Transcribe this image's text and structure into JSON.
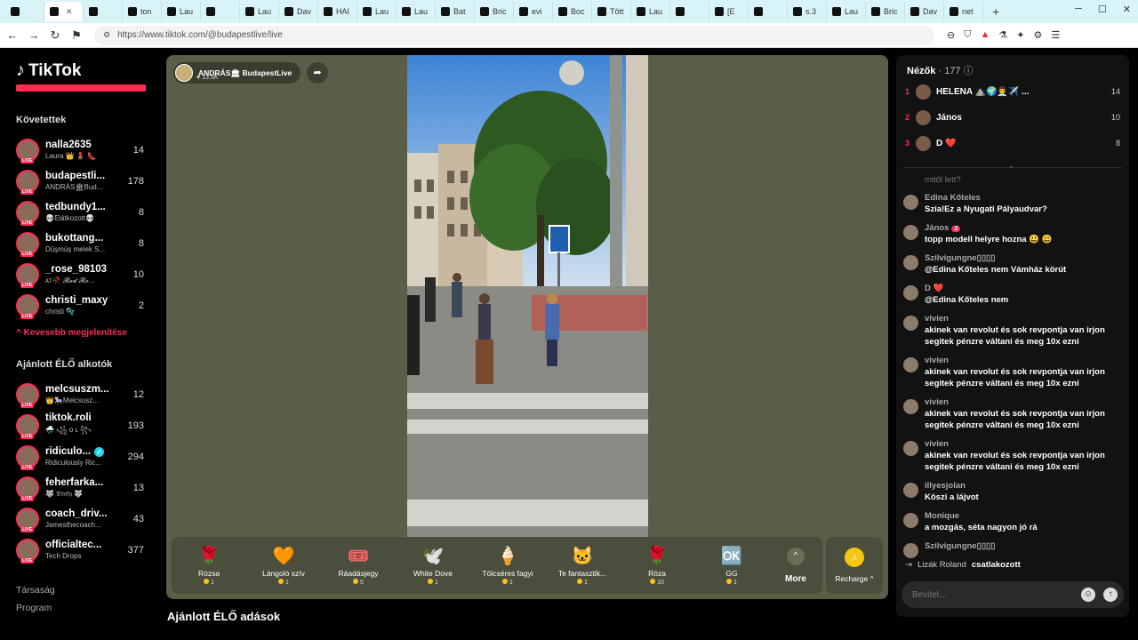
{
  "browser": {
    "tabs": [
      "",
      "",
      "",
      "ton",
      "Lau",
      "",
      "Lau",
      "Dav",
      "HAI",
      "Lau",
      "Lau",
      "Bat",
      "Bric",
      "evi",
      "Boc",
      "Tött",
      "Lau",
      "",
      "[E",
      "",
      "s.3",
      "Lau",
      "Bric",
      "Dav",
      "net"
    ],
    "url": "https://www.tiktok.com/@budapestlive/live"
  },
  "sidebar": {
    "logo": "TikTok",
    "following_title": "Követettek",
    "following": [
      {
        "name": "nalla2635",
        "sub": "Laura 👑 💄 👠",
        "count": "14"
      },
      {
        "name": "budapestli...",
        "sub": "ANDRÁS🏛Bud...",
        "count": "178"
      },
      {
        "name": "tedbundy1...",
        "sub": "💀Elátkozott💀",
        "count": "8"
      },
      {
        "name": "bukottang...",
        "sub": "Düşmüş melek S...",
        "count": "8"
      },
      {
        "name": "_rose_98103",
        "sub": "ᴀᴛ🥀 𝓡𝓮𝓭 𝓡𝓸...",
        "count": "10"
      },
      {
        "name": "christi_maxy",
        "sub": "christi 🫧",
        "count": "2"
      }
    ],
    "show_less": "Kevesebb megjelenítése",
    "recommended_title": "Ajánlott ÉLŐ alkotók",
    "recommended": [
      {
        "name": "melcsuszm...",
        "sub": "👑🎠Melcsusz...",
        "count": "12"
      },
      {
        "name": "tiktok.roli",
        "sub": "🌧️ ꧁ ᴏ ʟ ꧂",
        "count": "193"
      },
      {
        "name": "ridiculo...",
        "sub": "Ridiculously Ric...",
        "count": "294",
        "verified": true
      },
      {
        "name": "feherfarka...",
        "sub": "🐺 𝔅𝔦𝔫𝔣𝔶 🐺",
        "count": "13"
      },
      {
        "name": "coach_driv...",
        "sub": "Jamesthecoach...",
        "count": "43"
      },
      {
        "name": "officialtec...",
        "sub": "Tech Drops",
        "count": "377"
      }
    ],
    "footer": [
      "Társaság",
      "Program"
    ]
  },
  "player": {
    "host_name": "ANDRÁS🏛 BudapestLive",
    "host_likes": "♥ 13.5K",
    "gifts": [
      {
        "icon": "🌹",
        "name": "Rózsa",
        "price": "1"
      },
      {
        "icon": "🧡",
        "name": "Lángoló szív",
        "price": "1"
      },
      {
        "icon": "🎟️",
        "name": "Ráadásjegy",
        "price": "5"
      },
      {
        "icon": "🕊️",
        "name": "White Dove",
        "price": "1"
      },
      {
        "icon": "🍦",
        "name": "Tölcséres fagyi",
        "price": "1"
      },
      {
        "icon": "🐱",
        "name": "Te fantasztik...",
        "price": "1"
      },
      {
        "icon": "🌹",
        "name": "Róza",
        "price": "10"
      },
      {
        "icon": "🆗",
        "name": "GG",
        "price": "1"
      }
    ],
    "more_label": "More",
    "recharge_label": "Recharge ^"
  },
  "below_heading": "Ajánlott ÉLŐ adások",
  "chat": {
    "viewers_label": "Nézők",
    "viewers_count": "· 177",
    "top_viewers": [
      {
        "rank": "1",
        "name": "HELENA ⛰️🌍👨‍💼✈️ ...",
        "score": "14"
      },
      {
        "rank": "2",
        "name": "János",
        "score": "10"
      },
      {
        "rank": "3",
        "name": "D ❤️",
        "score": "8"
      }
    ],
    "partial_message": "mitől lett?",
    "messages": [
      {
        "user": "Edina Kőteles",
        "text": "Szia!Ez a Nyugati Pályaudvar?"
      },
      {
        "user": "János",
        "badge": "2",
        "text": "topp modell helyre hozna 😃 😃"
      },
      {
        "user": "Szilvigungne▯▯▯▯",
        "text": "@Edina Kőteles nem Vámház körút"
      },
      {
        "user": "D ❤️",
        "text": "@Edina Kőteles nem"
      },
      {
        "user": "vivien",
        "text": "akinek van revolut és sok revpontja van irjon segitek pénzre váltani és meg 10x ezni"
      },
      {
        "user": "vivien",
        "text": "akinek van revolut és sok revpontja van irjon segitek pénzre váltani és meg 10x ezni"
      },
      {
        "user": "vivien",
        "text": "akinek van revolut és sok revpontja van irjon segitek pénzre váltani és meg 10x ezni"
      },
      {
        "user": "vivien",
        "text": "akinek van revolut és sok revpontja van irjon segitek pénzre váltani és meg 10x ezni"
      },
      {
        "user": "illyesjolan",
        "text": "Köszi a lájvot"
      },
      {
        "user": "Monique",
        "text": "a mozgás, séta nagyon jó rá"
      },
      {
        "user": "Szilvigungne▯▯▯▯",
        "text": ""
      }
    ],
    "join_name": "Lizák Roland",
    "join_action": "csatlakozott",
    "input_placeholder": "Bevitel..."
  }
}
